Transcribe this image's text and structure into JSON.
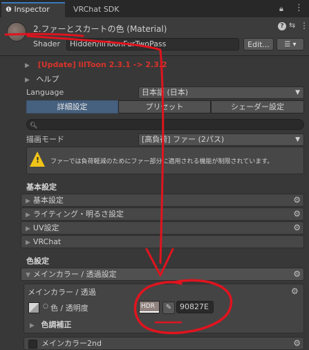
{
  "tabs": {
    "inspector": "Inspector",
    "vrchat_sdk": "VRChat SDK"
  },
  "header": {
    "title": "2.ファーとスカートの色 (Material)",
    "shader_label": "Shader",
    "shader_value": "Hidden/lilToonFurTwoPass",
    "edit_button": "Edit..."
  },
  "update_notice": "[Update] lilToon 2.3.1 -> 2.3.2",
  "help_label": "ヘルプ",
  "language": {
    "label": "Language",
    "value": "日本語 (日本)"
  },
  "mode_tabs": [
    "詳細設定",
    "プリセット",
    "シェーダー設定"
  ],
  "render_mode": {
    "label": "描画モード",
    "value": "[高負荷] ファー (2パス)"
  },
  "warning_text": "ファーでは負荷軽減のためにファー部分に適用される機能が制限されています。",
  "basic_settings": {
    "title": "基本設定",
    "items": [
      "基本設定",
      "ライティング・明るさ設定",
      "UV設定",
      "VRChat"
    ]
  },
  "color_settings": {
    "title": "色設定",
    "main_foldout": "メインカラー / 透過設定",
    "subsection_title": "メインカラー / 透過",
    "color_label": "色 / 透明度",
    "hdr_label": "HDR",
    "hex_value": "90827E",
    "color_correction": "色調補正",
    "main_color_2nd": "メインカラー2nd"
  },
  "colors": {
    "annotation_red": "#e0141e",
    "swatch": "#90827E",
    "accent_blue": "#3a79bb",
    "update_red": "#d9332b"
  }
}
